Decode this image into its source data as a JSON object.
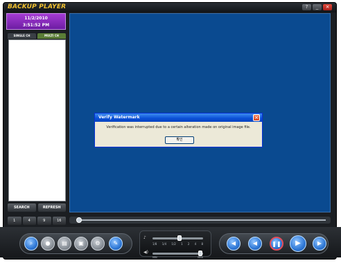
{
  "app": {
    "title": "BACKUP PLAYER"
  },
  "window_controls": {
    "help": "?",
    "minimize": "_",
    "close": "×"
  },
  "datetime": {
    "date": "11/2/2010",
    "time": "3:51:52 PM"
  },
  "tabs": [
    {
      "label": "SINGLE CH"
    },
    {
      "label": "MULTI CH"
    }
  ],
  "buttons": {
    "search": "SEARCH",
    "refresh": "REFRESH"
  },
  "channels": [
    "1",
    "4",
    "9",
    "16"
  ],
  "dialog": {
    "title": "Verify Watermark",
    "message": "Verification was interrupted due to a certain alteration made on original image file.",
    "ok": "확인"
  },
  "seek": {
    "position": 0.01
  },
  "speed": {
    "ticks": [
      "1/8",
      "1/4",
      "1/2",
      "1",
      "2",
      "4",
      "8"
    ],
    "level": 0.5
  },
  "volume": {
    "min": "MIN",
    "max": "MAX",
    "level": 0.95
  },
  "icons": {
    "tools": [
      "search-icon",
      "record-icon",
      "print-icon",
      "save-icon",
      "gear-icon",
      "watermark-icon"
    ],
    "playback": [
      "rewind-start-icon",
      "step-back-icon",
      "pause-icon",
      "play-icon",
      "step-forward-icon"
    ]
  }
}
